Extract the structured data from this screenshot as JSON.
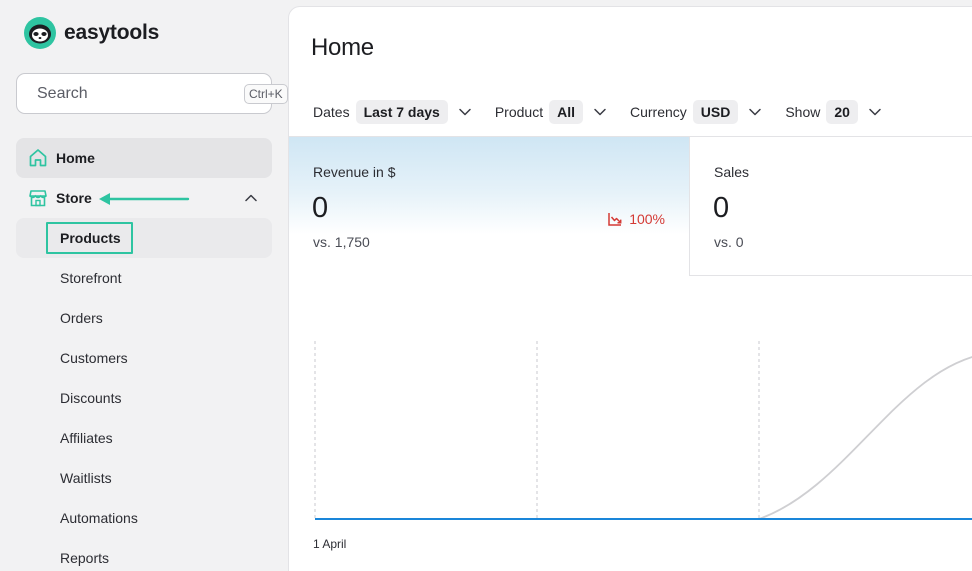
{
  "brand": {
    "name": "easytools"
  },
  "search": {
    "placeholder": "Search",
    "shortcut": "Ctrl+K"
  },
  "nav": {
    "home": "Home",
    "store": "Store",
    "store_items": [
      "Products",
      "Storefront",
      "Orders",
      "Customers",
      "Discounts",
      "Affiliates",
      "Waitlists",
      "Automations",
      "Reports"
    ],
    "selected_store_item": "Products"
  },
  "page": {
    "title": "Home"
  },
  "filters": [
    {
      "label": "Dates",
      "value": "Last 7 days"
    },
    {
      "label": "Product",
      "value": "All"
    },
    {
      "label": "Currency",
      "value": "USD"
    },
    {
      "label": "Show",
      "value": "20"
    }
  ],
  "stats": {
    "revenue": {
      "label": "Revenue in $",
      "value": "0",
      "comparison": "vs. 1,750",
      "change": "100%"
    },
    "sales": {
      "label": "Sales",
      "value": "0",
      "comparison": "vs. 0"
    }
  },
  "chart": {
    "first_x_label": "1 April"
  },
  "colors": {
    "accent": "#2ec4a1",
    "negative": "#d43a35",
    "line_current": "#1a86d9",
    "line_previous": "#cfcfd2"
  }
}
